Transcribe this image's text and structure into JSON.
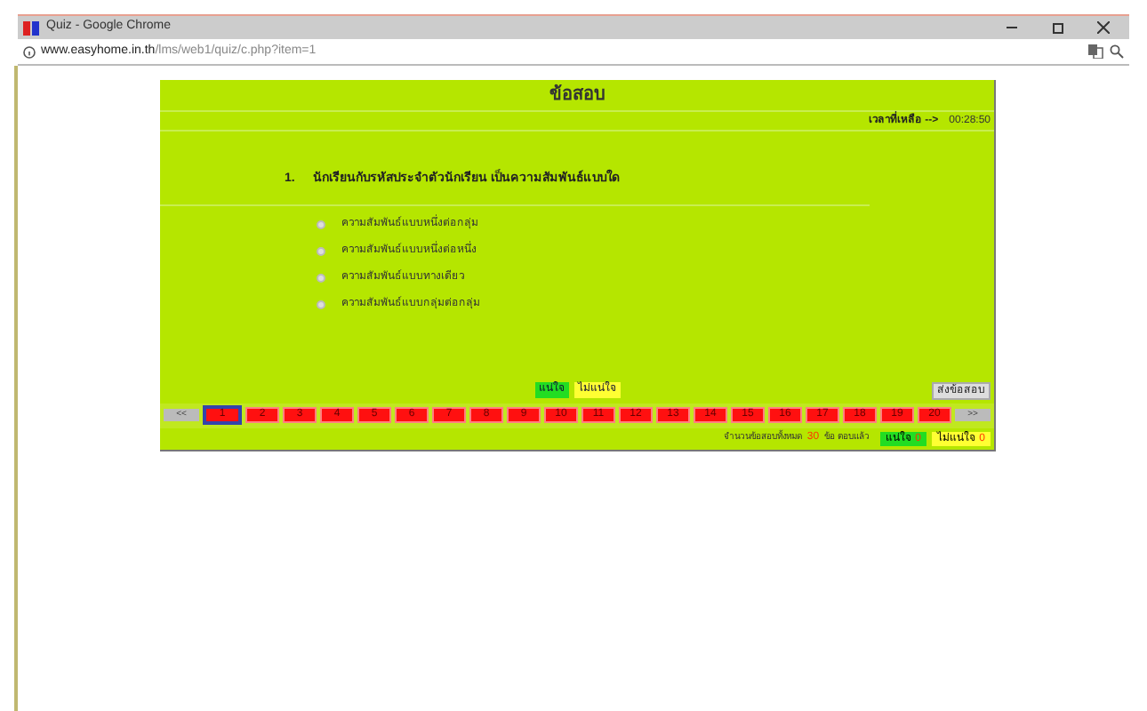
{
  "window": {
    "title": "Quiz - Google Chrome"
  },
  "address_bar": {
    "host": "www.easyhome.in.th",
    "path": "/lms/web1/quiz/c.php?item=1"
  },
  "quiz": {
    "title": "ข้อสอบ",
    "timer_label": "เวลาที่เหลือ -->",
    "timer": "00:28:50",
    "question": {
      "number": "1.",
      "text": "นักเรียนกับรหัสประจำตัวนักเรียน เป็นความสัมพันธ์แบบใด"
    },
    "options": [
      {
        "label": "ความสัมพันธ์แบบหนึ่งต่อกลุ่ม",
        "selected": false
      },
      {
        "label": "ความสัมพันธ์แบบหนึ่งต่อหนึ่ง",
        "selected": false
      },
      {
        "label": "ความสัมพันธ์แบบทางเดียว",
        "selected": false
      },
      {
        "label": "ความสัมพันธ์แบบกลุ่มต่อกลุ่ม",
        "selected": false
      }
    ],
    "sure_button": "แน่ใจ",
    "unsure_button": "ไม่แน่ใจ",
    "submit_button": "ส่งข้อสอบ",
    "prev_button": "<<",
    "next_button": ">>",
    "pages": [
      {
        "label": "1",
        "selected": true
      },
      {
        "label": "2",
        "selected": false
      },
      {
        "label": "3",
        "selected": false
      },
      {
        "label": "4",
        "selected": false
      },
      {
        "label": "5",
        "selected": false
      },
      {
        "label": "6",
        "selected": false
      },
      {
        "label": "7",
        "selected": false
      },
      {
        "label": "8",
        "selected": false
      },
      {
        "label": "9",
        "selected": false
      },
      {
        "label": "10",
        "selected": false
      },
      {
        "label": "11",
        "selected": false
      },
      {
        "label": "12",
        "selected": false
      },
      {
        "label": "13",
        "selected": false
      },
      {
        "label": "14",
        "selected": false
      },
      {
        "label": "15",
        "selected": false
      },
      {
        "label": "16",
        "selected": false
      },
      {
        "label": "17",
        "selected": false
      },
      {
        "label": "18",
        "selected": false
      },
      {
        "label": "19",
        "selected": false
      },
      {
        "label": "20",
        "selected": false
      }
    ],
    "summary": {
      "total_label": "จำนวนข้อสอบทั้งหมด",
      "total": "30",
      "unit_label": "ข้อ ตอบแล้ว",
      "sure_label": "แน่ใจ",
      "sure_count": "0",
      "unsure_label": "ไม่แน่ใจ",
      "unsure_count": "0"
    }
  }
}
